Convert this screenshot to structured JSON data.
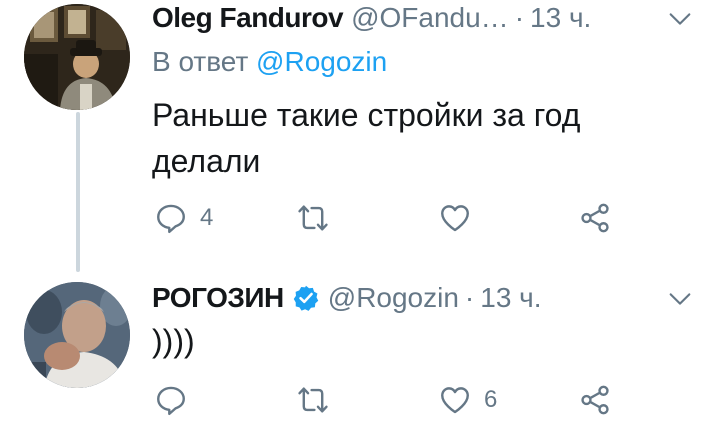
{
  "tweets": [
    {
      "name": "Oleg Fandurov",
      "handle": "@OFandu…",
      "separator": "·",
      "time": "13 ч.",
      "reply_prefix": "В ответ",
      "reply_mention": "@Rogozin",
      "text": "Раньше такие стройки за год делали",
      "reply_count": "4",
      "retweet_count": "",
      "like_count": "",
      "verified": false
    },
    {
      "name": "РОГОЗИН",
      "handle": "@Rogozin",
      "separator": "·",
      "time": "13 ч.",
      "text": "))))",
      "reply_count": "",
      "retweet_count": "",
      "like_count": "6",
      "verified": true
    }
  ],
  "colors": {
    "text": "#14171a",
    "secondary": "#657786",
    "accent": "#1da1f2",
    "thread_line": "#ccd6dd"
  },
  "icons": [
    "reply-icon",
    "retweet-icon",
    "like-icon",
    "share-icon",
    "chevron-down-icon",
    "verified-badge-icon"
  ]
}
